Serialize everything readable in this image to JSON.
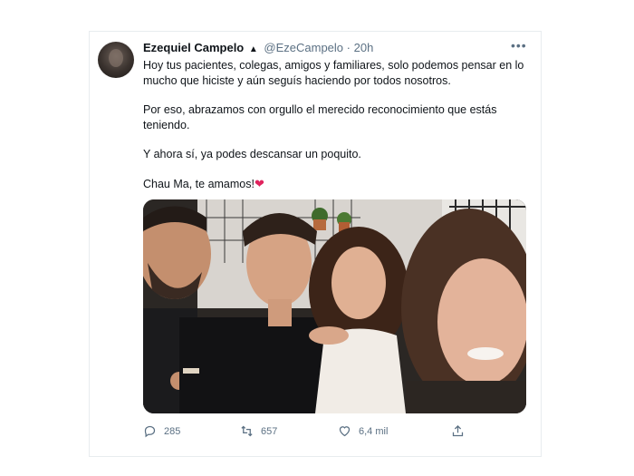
{
  "tweet": {
    "author_name": "Ezequiel Campelo",
    "verified_glyph": "▲",
    "handle": "@EzeCampelo",
    "separator": "·",
    "time": "20h",
    "more_glyph": "•••",
    "paragraphs": [
      "Hoy tus pacientes, colegas, amigos y familiares, solo podemos pensar en lo mucho que hiciste y aún seguís haciendo por todos nosotros.",
      "Por eso, abrazamos con orgullo el merecido reconocimiento que estás teniendo.",
      "Y ahora sí, ya podes descansar un poquito.",
      "Chau Ma, te amamos!"
    ],
    "heart_emoji": "❤"
  },
  "actions": {
    "reply_count": "285",
    "retweet_count": "657",
    "like_count": "6,4 mil"
  },
  "icons": [
    "reply-icon",
    "retweet-icon",
    "like-icon",
    "share-icon",
    "more-icon"
  ],
  "colors": {
    "text": "#0f1419",
    "muted": "#5b7083",
    "heart": "#e0245e"
  }
}
